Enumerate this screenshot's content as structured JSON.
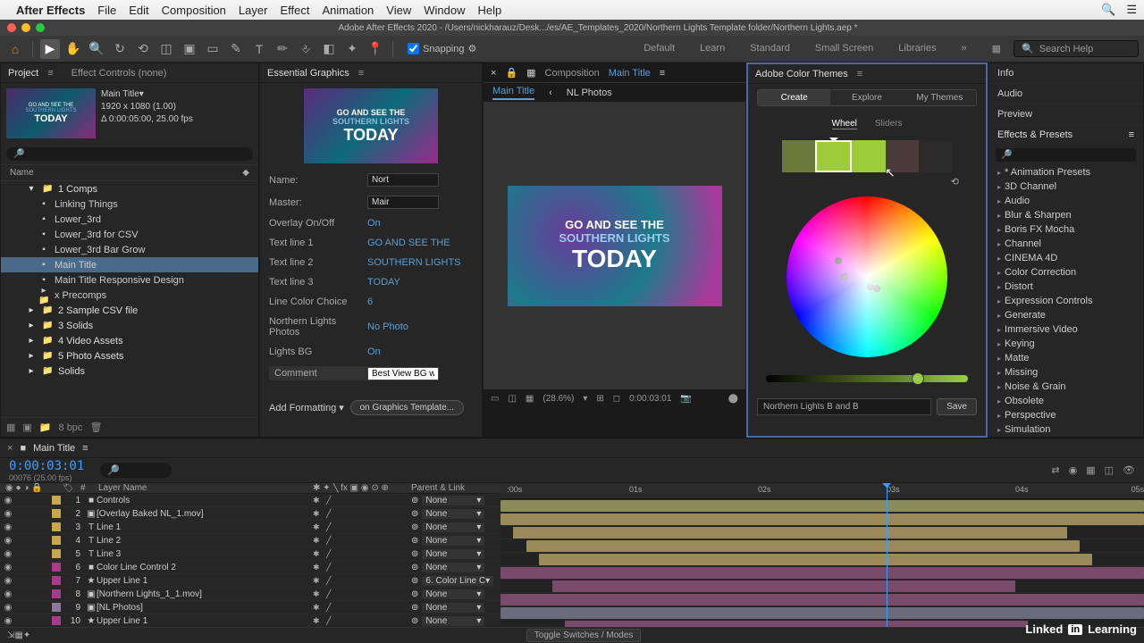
{
  "menubar": {
    "app": "After Effects",
    "items": [
      "File",
      "Edit",
      "Composition",
      "Layer",
      "Effect",
      "Animation",
      "View",
      "Window",
      "Help"
    ]
  },
  "window": {
    "title": "Adobe After Effects 2020 - /Users/nickharauz/Desk.../es/AE_Templates_2020/Northern Lights Template folder/Northern Lights.aep *"
  },
  "toolbar": {
    "snapping": "Snapping",
    "workspaces": [
      "Default",
      "Learn",
      "Standard",
      "Small Screen",
      "Libraries"
    ],
    "search_placeholder": "Search Help"
  },
  "panels": {
    "project": {
      "tab": "Project",
      "effect_tab": "Effect Controls (none)",
      "item_name": "Main Title",
      "meta1": "1920 x 1080 (1.00)",
      "meta2": "Δ 0:00:05:00, 25.00 fps",
      "col_name": "Name",
      "folders": [
        {
          "name": "1 Comps",
          "expanded": true,
          "children": [
            {
              "name": "Linking Things"
            },
            {
              "name": "Lower_3rd"
            },
            {
              "name": "Lower_3rd  for CSV"
            },
            {
              "name": "Lower_3rd Bar Grow"
            },
            {
              "name": "Main Title",
              "selected": true
            },
            {
              "name": "Main Title Responsive Design"
            },
            {
              "name": "x Precomps",
              "folder": true
            }
          ]
        },
        {
          "name": "2 Sample CSV file"
        },
        {
          "name": "3 Solids"
        },
        {
          "name": "4 Video Assets"
        },
        {
          "name": "5 Photo Assets"
        },
        {
          "name": "Solids"
        }
      ],
      "bpc": "8 bpc"
    },
    "eg": {
      "tab": "Essential Graphics",
      "preview": {
        "l1": "GO AND SEE THE",
        "l2": "SOUTHERN LIGHTS",
        "l3": "TODAY"
      },
      "name_lbl": "Name:",
      "name_val": "Nort",
      "master_lbl": "Master:",
      "master_val": "Mair",
      "props": [
        {
          "lbl": "Overlay On/Off",
          "val": "On"
        },
        {
          "lbl": "Text line 1",
          "val": "GO AND SEE THE"
        },
        {
          "lbl": "Text line 2",
          "val": "SOUTHERN LIGHTS"
        },
        {
          "lbl": "Text line 3",
          "val": "TODAY"
        },
        {
          "lbl": "Line Color Choice",
          "val": "6"
        },
        {
          "lbl": "Northern Lights Photos",
          "val": "No Photo"
        },
        {
          "lbl": "Lights BG",
          "val": "On"
        }
      ],
      "comment_lbl": "Comment",
      "comment_val": "Best View BG with",
      "add_formatting": "Add Formatting",
      "export_btn": "on Graphics Template..."
    },
    "comp": {
      "lbl": "Composition",
      "name": "Main Title",
      "subtabs": [
        "Main Title",
        "NL Photos"
      ],
      "preview": {
        "l1": "GO AND SEE THE",
        "l2": "SOUTHERN LIGHTS",
        "l3": "TODAY"
      },
      "zoom": "(28.6%)",
      "time": "0:00:03:01"
    },
    "color": {
      "tab": "Adobe Color Themes",
      "modes": [
        "Create",
        "Explore",
        "My Themes"
      ],
      "submodes": [
        "Wheel",
        "Sliders"
      ],
      "swatches": [
        "#6a7a3a",
        "#9ccc3a",
        "#9ccc3a",
        "#4a3a3a",
        "#2a2a2a"
      ],
      "theme_name": "Northern Lights B and B",
      "save": "Save"
    },
    "right": {
      "items": [
        "Info",
        "Audio",
        "Preview"
      ],
      "ep_header": "Effects & Presets",
      "cats": [
        "* Animation Presets",
        "3D Channel",
        "Audio",
        "Blur & Sharpen",
        "Boris FX Mocha",
        "Channel",
        "CINEMA 4D",
        "Color Correction",
        "Distort",
        "Expression Controls",
        "Generate",
        "Immersive Video",
        "Keying",
        "Matte",
        "Missing",
        "Noise & Grain",
        "Obsolete",
        "Perspective",
        "Simulation"
      ]
    }
  },
  "timeline": {
    "tab": "Main Title",
    "time": "0:00:03:01",
    "time_sub": "00076 (25.00 fps)",
    "col_layer": "Layer Name",
    "col_parent": "Parent & Link",
    "ruler": [
      ":00s",
      "01s",
      "02s",
      "03s",
      "04s",
      "05s"
    ],
    "layers": [
      {
        "n": 1,
        "c": "#c7a84a",
        "ico": "■",
        "name": "Controls",
        "parent": "None"
      },
      {
        "n": 2,
        "c": "#c7a84a",
        "ico": "▣",
        "name": "[Overlay Baked NL_1.mov]",
        "parent": "None"
      },
      {
        "n": 3,
        "c": "#c7a84a",
        "ico": "T",
        "name": "Line 1",
        "parent": "None"
      },
      {
        "n": 4,
        "c": "#c7a84a",
        "ico": "T",
        "name": "Line 2",
        "parent": "None"
      },
      {
        "n": 5,
        "c": "#c7a84a",
        "ico": "T",
        "name": "Line 3",
        "parent": "None"
      },
      {
        "n": 6,
        "c": "#aa3a8a",
        "ico": "■",
        "name": "Color Line Control 2",
        "parent": "None"
      },
      {
        "n": 7,
        "c": "#aa3a8a",
        "ico": "★",
        "name": "Upper Line 1",
        "parent": "6. Color Line C"
      },
      {
        "n": 8,
        "c": "#aa3a8a",
        "ico": "▣",
        "name": "[Northern Lights_1_1.mov]",
        "parent": "None"
      },
      {
        "n": 9,
        "c": "#8a7a9a",
        "ico": "▣",
        "name": "[NL Photos]",
        "parent": "None"
      },
      {
        "n": 10,
        "c": "#aa3a8a",
        "ico": "★",
        "name": "Upper Line 1",
        "parent": "None"
      }
    ],
    "toggle": "Toggle Switches / Modes"
  },
  "branding": {
    "linkedin": "Linked",
    "in": "in",
    "learning": "Learning"
  }
}
